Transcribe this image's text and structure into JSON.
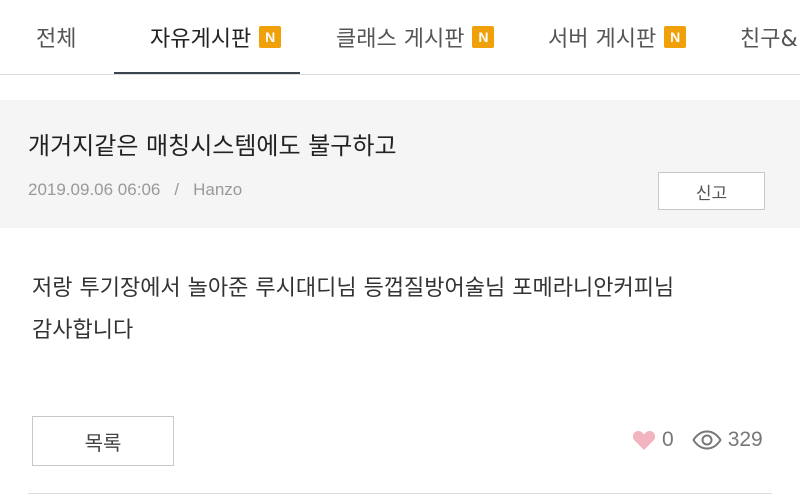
{
  "tabs": [
    {
      "label": "전체",
      "new_badge": ""
    },
    {
      "label": "자유게시판",
      "new_badge": "N"
    },
    {
      "label": "클래스 게시판",
      "new_badge": "N"
    },
    {
      "label": "서버 게시판",
      "new_badge": "N"
    },
    {
      "label": "친구&",
      "new_badge": ""
    }
  ],
  "active_tab": "자유게시판",
  "post": {
    "title": "개거지같은 매칭시스템에도 불구하고",
    "datetime": "2019.09.06 06:06",
    "separator": "/",
    "author": "Hanzo",
    "report_label": "신고",
    "body_line1": "저랑 투기장에서 놀아준 루시대디님 등껍질방어술님 포메라니안커피님",
    "body_line2": "감사합니다"
  },
  "footer": {
    "list_label": "목록",
    "likes": "0",
    "views": "329"
  },
  "icons": {
    "like": "heart-icon",
    "views": "eye-icon"
  },
  "colors": {
    "badge": "#f0a10a",
    "active_underline": "#3b4550",
    "heart": "#f2b5c0"
  }
}
